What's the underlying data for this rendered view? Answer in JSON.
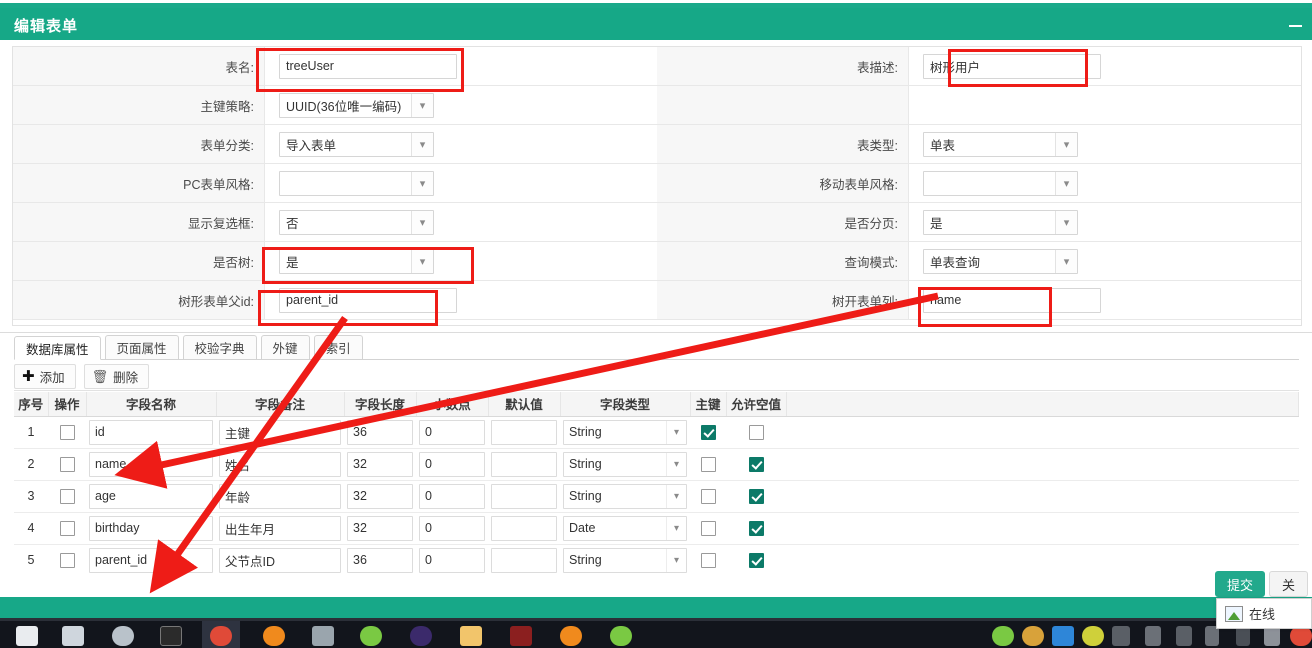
{
  "window": {
    "title": "编辑表单",
    "minimize_label": "—"
  },
  "form": {
    "rows": [
      {
        "left": {
          "label": "表名:",
          "type": "text",
          "value": "treeUser",
          "highlight": true
        },
        "right": {
          "label": "表描述:",
          "type": "text",
          "value": "树形用户",
          "highlight": true
        }
      },
      {
        "left": {
          "label": "主键策略:",
          "type": "select",
          "value": "UUID(36位唯一编码)"
        },
        "right": {
          "label": "",
          "type": "none",
          "value": ""
        }
      },
      {
        "left": {
          "label": "表单分类:",
          "type": "select",
          "value": "导入表单"
        },
        "right": {
          "label": "表类型:",
          "type": "select",
          "value": "单表"
        }
      },
      {
        "left": {
          "label": "PC表单风格:",
          "type": "select",
          "value": ""
        },
        "right": {
          "label": "移动表单风格:",
          "type": "select",
          "value": ""
        }
      },
      {
        "left": {
          "label": "显示复选框:",
          "type": "select",
          "value": "否"
        },
        "right": {
          "label": "是否分页:",
          "type": "select",
          "value": "是"
        }
      },
      {
        "left": {
          "label": "是否树:",
          "type": "select",
          "value": "是",
          "highlight": true
        },
        "right": {
          "label": "查询模式:",
          "type": "select",
          "value": "单表查询"
        }
      },
      {
        "left": {
          "label": "树形表单父id:",
          "type": "text",
          "value": "parent_id",
          "highlight": true
        },
        "right": {
          "label": "树开表单列:",
          "type": "text",
          "value": "name",
          "highlight": true
        }
      }
    ]
  },
  "tabs": [
    {
      "label": "数据库属性",
      "active": true
    },
    {
      "label": "页面属性",
      "active": false
    },
    {
      "label": "校验字典",
      "active": false
    },
    {
      "label": "外键",
      "active": false
    },
    {
      "label": "索引",
      "active": false
    }
  ],
  "toolbar": {
    "add_label": "添加",
    "add_icon": "plus-icon",
    "delete_label": "删除",
    "delete_icon": "trash-icon"
  },
  "grid": {
    "columns": [
      "序号",
      "操作",
      "字段名称",
      "字段备注",
      "字段长度",
      "小数点",
      "默认值",
      "字段类型",
      "主键",
      "允许空值"
    ],
    "rows": [
      {
        "no": "1",
        "selected": false,
        "field_name": "id",
        "field_remark": "主键",
        "length": "36",
        "decimal": "0",
        "default": "",
        "type": "String",
        "primary_key": true,
        "nullable": false
      },
      {
        "no": "2",
        "selected": false,
        "field_name": "name",
        "field_remark": "姓名",
        "length": "32",
        "decimal": "0",
        "default": "",
        "type": "String",
        "primary_key": false,
        "nullable": true
      },
      {
        "no": "3",
        "selected": false,
        "field_name": "age",
        "field_remark": "年龄",
        "length": "32",
        "decimal": "0",
        "default": "",
        "type": "String",
        "primary_key": false,
        "nullable": true
      },
      {
        "no": "4",
        "selected": false,
        "field_name": "birthday",
        "field_remark": "出生年月",
        "length": "32",
        "decimal": "0",
        "default": "",
        "type": "Date",
        "primary_key": false,
        "nullable": true
      },
      {
        "no": "5",
        "selected": false,
        "field_name": "parent_id",
        "field_remark": "父节点ID",
        "length": "36",
        "decimal": "0",
        "default": "",
        "type": "String",
        "primary_key": false,
        "nullable": true
      }
    ]
  },
  "footer": {
    "submit_label": "提交",
    "close_label": "关"
  },
  "tray": {
    "popup_text": "在线",
    "popup_icon": "picture-icon"
  },
  "colors": {
    "accent_teal": "#16a887",
    "annotation_red": "#ee1c17",
    "checkbox_green": "#0c7a68",
    "submit_green": "#22a98c"
  }
}
